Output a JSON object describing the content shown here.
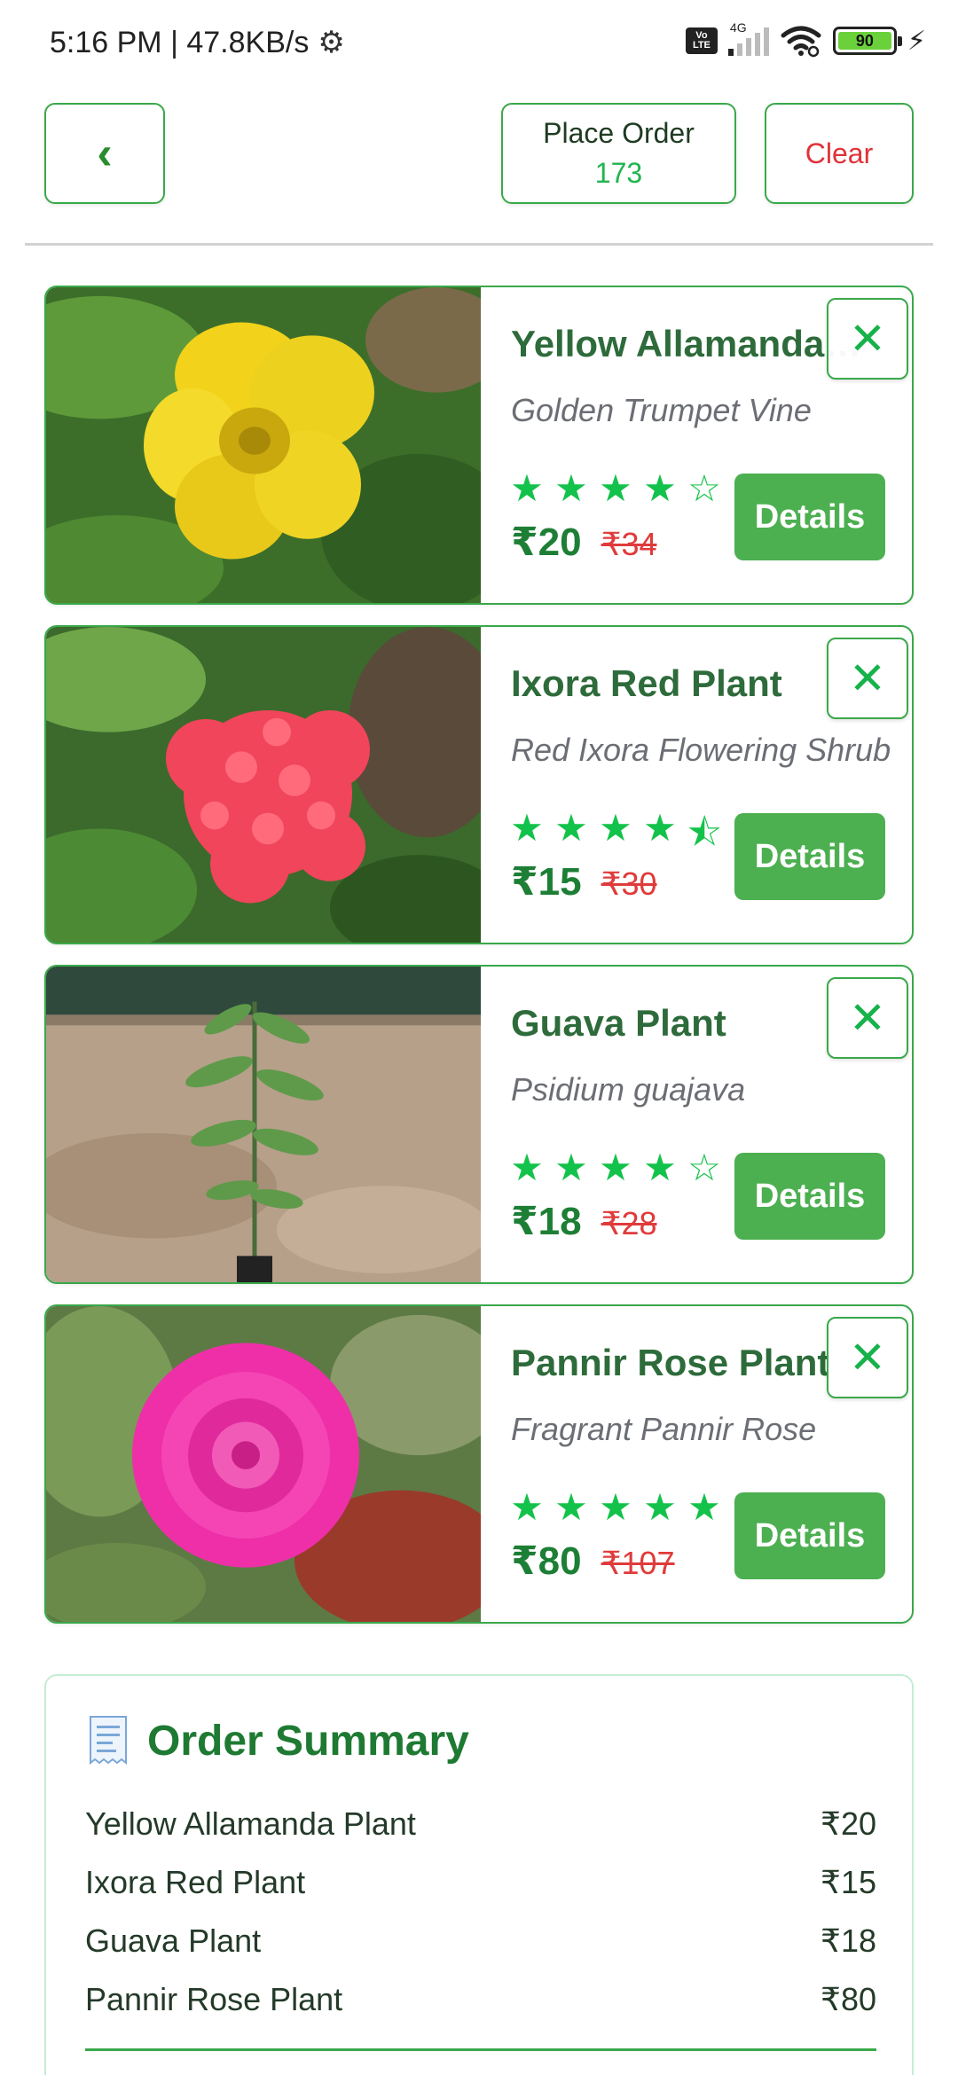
{
  "status_bar": {
    "time_speed": "5:16 PM | 47.8KB/s",
    "network_label": "4G",
    "volte_line1": "Vo",
    "volte_line2": "LTE",
    "battery": "90"
  },
  "header": {
    "back_icon": "‹",
    "place_order_label": "Place Order",
    "place_order_count": "173",
    "clear_label": "Clear"
  },
  "icons": {
    "close": "✕"
  },
  "items": [
    {
      "name": "Yellow Allamanda Plant",
      "scientific": "Golden Trumpet Vine",
      "rating": 4,
      "stars": [
        "★",
        "★",
        "★",
        "★",
        "☆"
      ],
      "price": "₹20",
      "old_price": "₹34",
      "details_label": "Details"
    },
    {
      "name": "Ixora Red Plant",
      "scientific": "Red Ixora Flowering Shrub",
      "rating": 4.5,
      "stars": [
        "★",
        "★",
        "★",
        "★",
        "⯪"
      ],
      "price": "₹15",
      "old_price": "₹30",
      "details_label": "Details"
    },
    {
      "name": "Guava Plant",
      "scientific": "Psidium guajava",
      "rating": 4,
      "stars": [
        "★",
        "★",
        "★",
        "★",
        "☆"
      ],
      "price": "₹18",
      "old_price": "₹28",
      "details_label": "Details"
    },
    {
      "name": "Pannir Rose Plant",
      "scientific": "Fragrant Pannir Rose",
      "rating": 5,
      "stars": [
        "★",
        "★",
        "★",
        "★",
        "★"
      ],
      "price": "₹80",
      "old_price": "₹107",
      "details_label": "Details"
    }
  ],
  "summary": {
    "title": "Order Summary",
    "rows": [
      {
        "name": "Yellow Allamanda Plant",
        "price": "₹20"
      },
      {
        "name": "Ixora Red Plant",
        "price": "₹15"
      },
      {
        "name": "Guava Plant",
        "price": "₹18"
      },
      {
        "name": "Pannir Rose Plant",
        "price": "₹80"
      }
    ]
  },
  "colors": {
    "accent_green": "#4caf50",
    "border_green": "#3aa84a",
    "price_green": "#1d7f35",
    "star_green": "#13c24a",
    "strike_red": "#e03b3b",
    "clear_red": "#e0323a"
  }
}
